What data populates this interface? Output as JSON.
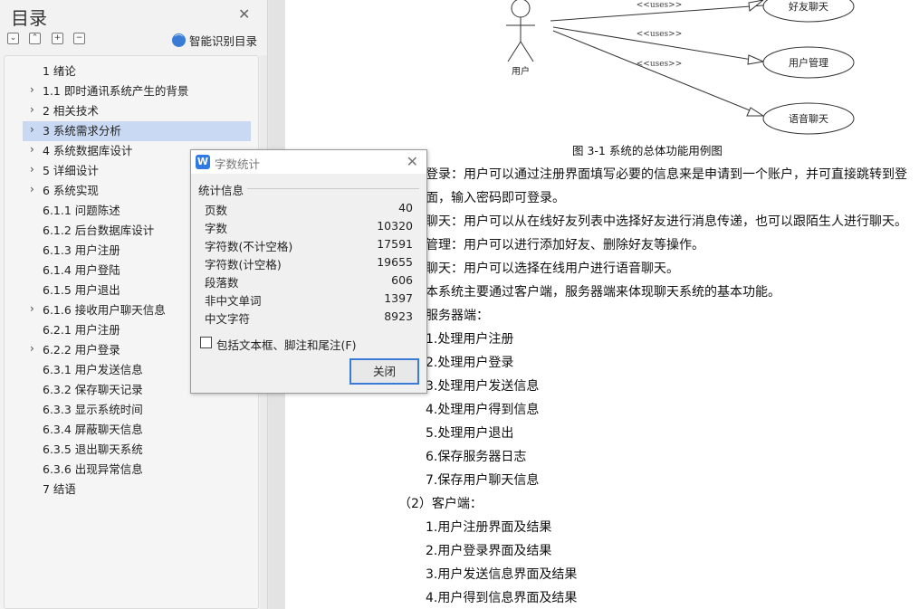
{
  "sidebar": {
    "title": "目录",
    "smart_label": "智能识别目录",
    "items": [
      {
        "label": "1 绪论"
      },
      {
        "label": "1.1 即时通讯系统产生的背景"
      },
      {
        "label": "2 相关技术"
      },
      {
        "label": "3 系统需求分析"
      },
      {
        "label": "4 系统数据库设计"
      },
      {
        "label": "5  详细设计"
      },
      {
        "label": "6  系统实现"
      },
      {
        "label": "6.1.1  问题陈述"
      },
      {
        "label": "6.1.2  后台数据库设计"
      },
      {
        "label": "6.1.3 用户注册"
      },
      {
        "label": "6.1.4 用户登陆"
      },
      {
        "label": "6.1.5 用户退出"
      },
      {
        "label": "6.1.6  接收用户聊天信息"
      },
      {
        "label": "6.2.1  用户注册"
      },
      {
        "label": "6.2.2  用户登录"
      },
      {
        "label": "6.3.1  用户发送信息"
      },
      {
        "label": "6.3.2  保存聊天记录"
      },
      {
        "label": "6.3.3 显示系统时间"
      },
      {
        "label": "6.3.4 屏蔽聊天信息"
      },
      {
        "label": "6.3.5  退出聊天系统"
      },
      {
        "label": "6.3.6 出现异常信息"
      },
      {
        "label": "7 结语"
      }
    ]
  },
  "diagram": {
    "actor_label": "用户",
    "uses_label": "<<uses>>",
    "use_cases": [
      "好友聊天",
      "用户管理",
      "语音聊天"
    ]
  },
  "document": {
    "caption": "图 3-1  系统的总体功能用例图",
    "lines": [
      "登录：用户可以通过注册界面填写必要的信息来是申请到一个账户，并可直接跳转到登",
      "面，输入密码即可登录。",
      "聊天：用户可以从在线好友列表中选择好友进行消息传递，也可以跟陌生人进行聊天。",
      "管理：用户可以进行添加好友、删除好友等操作。",
      "聊天：用户可以选择在线用户进行语音聊天。",
      "本系统主要通过客户端，服务器端来体现聊天系统的基本功能。",
      "服务器端：",
      "1.处理用户注册",
      "2.处理用户登录",
      "3.处理用户发送信息",
      "4.处理用户得到信息",
      "5.处理用户退出",
      "6.保存服务器日志",
      "7.保存用户聊天信息",
      "（2）客户端：",
      "1.用户注册界面及结果",
      "2.用户登录界面及结果",
      "3.用户发送信息界面及结果",
      "4.用户得到信息界面及结果"
    ]
  },
  "dialog": {
    "title": "字数统计",
    "group_label": "统计信息",
    "stats": [
      {
        "label": "页数",
        "value": "40"
      },
      {
        "label": "字数",
        "value": "10320"
      },
      {
        "label": "字符数(不计空格)",
        "value": "17591"
      },
      {
        "label": "字符数(计空格)",
        "value": "19655"
      },
      {
        "label": "段落数",
        "value": "606"
      },
      {
        "label": "非中文单词",
        "value": "1397"
      },
      {
        "label": "中文字符",
        "value": "8923"
      }
    ],
    "include_label": "包括文本框、脚注和尾注(F)",
    "close_label": "关闭"
  }
}
